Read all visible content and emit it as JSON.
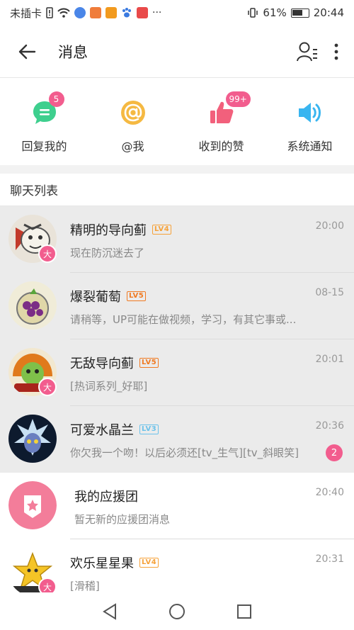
{
  "status_bar": {
    "carrier": "未插卡",
    "battery": "61%",
    "time": "20:44"
  },
  "header": {
    "title": "消息"
  },
  "quick_actions": [
    {
      "label": "回复我的",
      "badge": "5",
      "icon": "chat-bubble-icon",
      "color": "#3ecf8e"
    },
    {
      "label": "@我",
      "badge": "",
      "icon": "at-sign-icon",
      "color": "#f5b942"
    },
    {
      "label": "收到的赞",
      "badge": "99+",
      "icon": "thumbs-up-icon",
      "color": "#f2607c"
    },
    {
      "label": "系统通知",
      "badge": "",
      "icon": "speaker-icon",
      "color": "#39b5f0"
    }
  ],
  "section": {
    "title": "聊天列表"
  },
  "chats": [
    {
      "name": "精明的导向蓟",
      "level": "LV4",
      "time": "20:00",
      "preview": "现在防沉迷去了",
      "unread": "",
      "badge": "大"
    },
    {
      "name": "爆裂葡萄",
      "level": "LV5",
      "time": "08-15",
      "preview": "请稍等，UP可能在做视频，学习，有其它事或...",
      "unread": "",
      "badge": ""
    },
    {
      "name": "无敌导向蓟",
      "level": "LV5",
      "time": "20:01",
      "preview": "[热词系列_好耶]",
      "unread": "",
      "badge": "大"
    },
    {
      "name": "可爱水晶兰",
      "level": "LV3",
      "time": "20:36",
      "preview": "你欠我一个吻！以后必须还[tv_生气][tv_斜眼笑]",
      "unread": "2",
      "badge": ""
    },
    {
      "name": "我的应援团",
      "level": "",
      "time": "20:40",
      "preview": "暂无新的应援团消息",
      "unread": "",
      "badge": ""
    },
    {
      "name": "欢乐星星果",
      "level": "LV4",
      "time": "20:31",
      "preview": "[滑稽]",
      "unread": "",
      "badge": "大"
    }
  ],
  "colors": {
    "accent": "#f25d8e",
    "lv3": "#6cc2ea",
    "lv4": "#f6a23a",
    "lv5": "#f07a22"
  }
}
